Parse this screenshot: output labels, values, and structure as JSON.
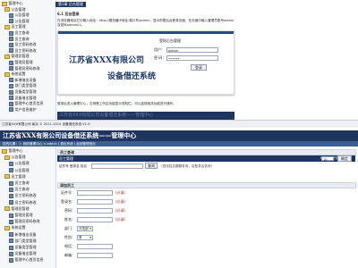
{
  "top": {
    "tree": [
      {
        "label": "管理中心",
        "icon": "folder"
      },
      {
        "label": "公告管理",
        "icon": "folder"
      },
      {
        "label": "公告管理",
        "icon": "file"
      },
      {
        "label": "公告管理",
        "icon": "file"
      },
      {
        "label": "员工管理",
        "icon": "folder"
      },
      {
        "label": "员工查询",
        "icon": "file"
      },
      {
        "label": "员工查询",
        "icon": "file"
      },
      {
        "label": "员工密码修改",
        "icon": "file"
      },
      {
        "label": "员工密码修改",
        "icon": "file"
      },
      {
        "label": "管理员管理",
        "icon": "folder"
      },
      {
        "label": "管理员管理",
        "icon": "file"
      },
      {
        "label": "管理员密码修改",
        "icon": "file"
      },
      {
        "label": "系统设置",
        "icon": "folder"
      },
      {
        "label": "新增借出设备",
        "icon": "file"
      },
      {
        "label": "部门类型管理",
        "icon": "file"
      },
      {
        "label": "设备类型管理",
        "icon": "file"
      },
      {
        "label": "设备借出管理",
        "icon": "file"
      },
      {
        "label": "管理中心首页信息",
        "icon": "file"
      },
      {
        "label": "用户信息维护",
        "icon": "file"
      }
    ],
    "tab_label": "第1章 后台管理",
    "section_title": "6.1 后台登录",
    "section_desc": "在浏览器地址栏中输入地址：http://服务器IP地址:端口号/admin，显示的是后台登录页面，在页面中输入管理员账号admin及密码admin01。",
    "login_title": "登陆后台管理",
    "user_label": "用户：",
    "user_value": "admin",
    "pwd_label": "密 码：",
    "pwd_value": "••••••",
    "login_btn": "登录",
    "company": "江苏省XXX有限公司",
    "system": "设备借还系统",
    "caption": "登录后进入管理中心，左侧是工作区功能显示导航栏，可以选择相关功能进行操作。",
    "banner_text": "江苏省XXX有限公司设备借还系统——管理中心",
    "footer": "江苏省XXX有限公司 南京 © 2011-2015 设备借还系统 V1.0"
  },
  "bottom": {
    "header_title": "江苏省XXX有限公司设备借还系统——管理中心",
    "breadcrumb": "您的位置：＞ 我的管理中心 > admin | 退出系统 | 返回管理首页",
    "tree": [
      {
        "label": "管理中心",
        "icon": "folder"
      },
      {
        "label": "公告管理",
        "icon": "folder"
      },
      {
        "label": "公告管理",
        "icon": "file"
      },
      {
        "label": "公告管理",
        "icon": "file"
      },
      {
        "label": "员工管理",
        "icon": "folder"
      },
      {
        "label": "员工查询",
        "icon": "file"
      },
      {
        "label": "员工查询",
        "icon": "file"
      },
      {
        "label": "员工密码修改",
        "icon": "file"
      },
      {
        "label": "员工密码修改",
        "icon": "file"
      },
      {
        "label": "管理员管理",
        "icon": "folder"
      },
      {
        "label": "管理员管理",
        "icon": "file"
      },
      {
        "label": "管理员密码修改",
        "icon": "file"
      },
      {
        "label": "系统设置",
        "icon": "folder"
      },
      {
        "label": "新增借出设备",
        "icon": "file"
      },
      {
        "label": "部门类型管理",
        "icon": "file"
      },
      {
        "label": "设备类型管理",
        "icon": "file"
      },
      {
        "label": "设备借出管理",
        "icon": "file"
      },
      {
        "label": "管理中心首页信息",
        "icon": "file"
      }
    ],
    "query_panel_title": "员工查询",
    "query_bar_title": "员工管理",
    "page_size_label": "每页显示行数：",
    "page_size_value": "10",
    "page_size_btn": "确定",
    "query_label": "证件号 登录名 姓名",
    "query_value": "",
    "query_btn": "查询",
    "query_hint": "（查找姓名模糊查询，及登录名查询）",
    "add_panel_title": "添加员工",
    "fields": [
      {
        "label": "证件号：",
        "value": "",
        "note": "(必填)"
      },
      {
        "label": "登录名：",
        "value": "",
        "note": "(必填)"
      },
      {
        "label": "密码：",
        "value": "",
        "note": "(必填)"
      },
      {
        "label": "姓名：",
        "value": "",
        "note": "(必填)"
      },
      {
        "label": "部门：",
        "value": "开发部",
        "note": ""
      },
      {
        "label": "性别：",
        "value": "男",
        "note": ""
      },
      {
        "label": "电话：",
        "value": "",
        "note": ""
      },
      {
        "label": "邮箱：",
        "value": "",
        "note": ""
      }
    ]
  },
  "colors": {
    "navy": "#1e3560",
    "accent": "#c0392b",
    "panel": "#e8ecf2"
  }
}
